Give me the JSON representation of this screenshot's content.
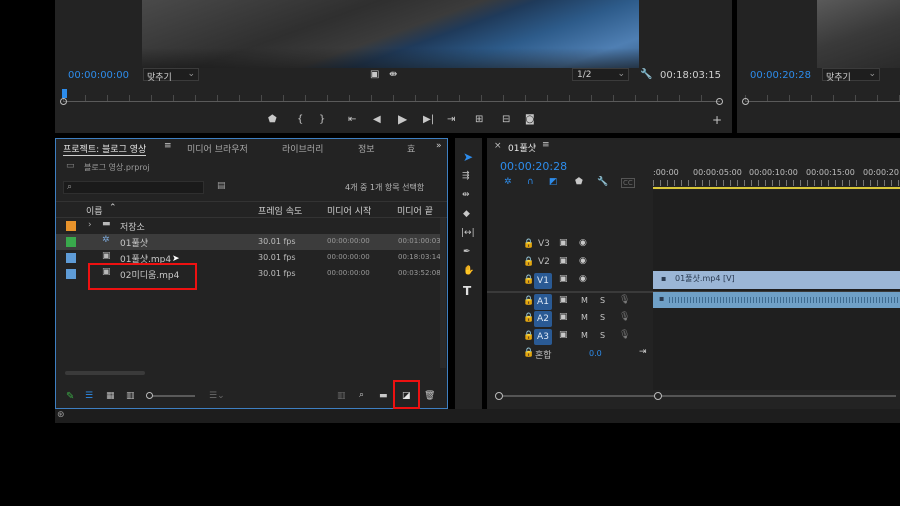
{
  "program_monitor": {
    "timecode_left": "00:00:00:00",
    "fit_label": "맞추기",
    "fraction": "1/2",
    "timecode_right": "00:18:03:15"
  },
  "source_monitor": {
    "timecode": "00:00:20:28",
    "fit_label": "맞추기"
  },
  "project_panel": {
    "tabs": [
      "프로젝트: 블로그 영상",
      "미디어 브라우저",
      "라이브러리",
      "정보",
      "효"
    ],
    "project_file": "블로그 영상.prproj",
    "selection_status": "4개 중 1개 항목 선택함",
    "columns": [
      "이름",
      "프레임 속도",
      "미디어 시작",
      "미디어 끝"
    ],
    "rows": [
      {
        "name": "저장소",
        "type": "bin",
        "color": "#e8932b",
        "fps": "",
        "start": "",
        "end": ""
      },
      {
        "name": "01풀샷",
        "type": "sequence",
        "color": "#39a94c",
        "fps": "30.01 fps",
        "start": "00:00:00:00",
        "end": "00:01:00:03"
      },
      {
        "name": "01풀샷.mp4",
        "type": "clip",
        "color": "#5e9bd6",
        "fps": "30.01 fps",
        "start": "00:00:00:00",
        "end": "00:18:03:14"
      },
      {
        "name": "02미디움.mp4",
        "type": "clip",
        "color": "#5e9bd6",
        "fps": "30.01 fps",
        "start": "00:00:00:00",
        "end": "00:03:52:08"
      }
    ]
  },
  "timeline": {
    "sequence_tab": "01풀샷",
    "timecode": "00:00:20:28",
    "ruler": [
      ":00:00",
      "00:00:05:00",
      "00:00:10:00",
      "00:00:15:00",
      "00:00:20"
    ],
    "video_tracks": [
      "V3",
      "V2",
      "V1"
    ],
    "audio_tracks": [
      "A1",
      "A2",
      "A3"
    ],
    "mute_label": "M",
    "solo_label": "S",
    "mix_label": "혼합",
    "mix_value": "0.0",
    "clip_label": "01풀샷.mp4 [V]",
    "cc_label": "CC"
  },
  "tools": [
    "selection",
    "track-select",
    "ripple-edit",
    "razor",
    "slip",
    "pen",
    "hand",
    "type"
  ],
  "colors": {
    "accent": "#2d8ceb",
    "panel": "#232323",
    "highlight": "#e11111"
  }
}
